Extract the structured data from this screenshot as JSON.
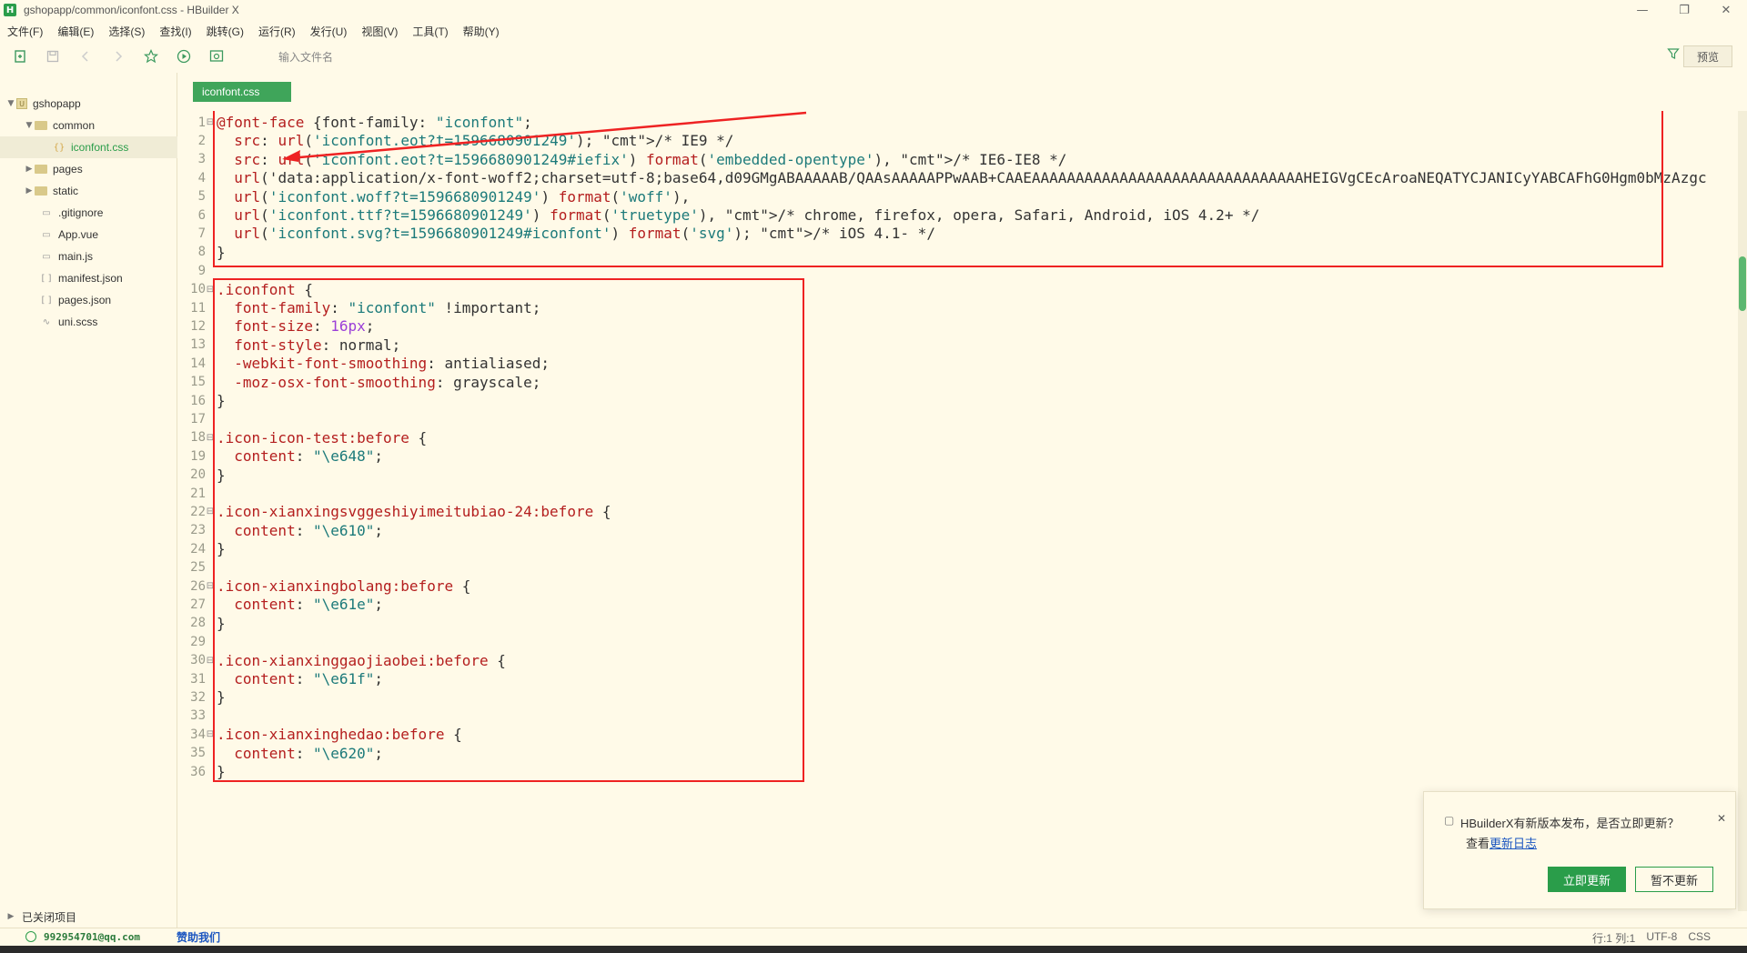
{
  "window": {
    "app_logo": "H",
    "title": "gshopapp/common/iconfont.css - HBuilder X",
    "controls": {
      "minimize": "—",
      "restore": "❐",
      "close": "✕"
    }
  },
  "menu": [
    "文件(F)",
    "编辑(E)",
    "选择(S)",
    "查找(I)",
    "跳转(G)",
    "运行(R)",
    "发行(U)",
    "视图(V)",
    "工具(T)",
    "帮助(Y)"
  ],
  "toolbar": {
    "search_placeholder": "输入文件名",
    "preview_label": "预览"
  },
  "sidebar": {
    "project": "gshopapp",
    "items": [
      {
        "label": "gshopapp",
        "type": "project"
      },
      {
        "label": "common",
        "type": "folder"
      },
      {
        "label": "iconfont.css",
        "type": "css"
      },
      {
        "label": "pages",
        "type": "folder"
      },
      {
        "label": "static",
        "type": "folder"
      },
      {
        "label": ".gitignore",
        "type": "file"
      },
      {
        "label": "App.vue",
        "type": "file"
      },
      {
        "label": "main.js",
        "type": "file"
      },
      {
        "label": "manifest.json",
        "type": "json"
      },
      {
        "label": "pages.json",
        "type": "json"
      },
      {
        "label": "uni.scss",
        "type": "file"
      }
    ],
    "footer": "已关闭项目"
  },
  "editor": {
    "tab_label": "iconfont.css",
    "lines": [
      "@font-face {font-family: \"iconfont\";",
      "  src: url('iconfont.eot?t=1596680901249'); /* IE9 */",
      "  src: url('iconfont.eot?t=1596680901249#iefix') format('embedded-opentype'), /* IE6-IE8 */",
      "  url('data:application/x-font-woff2;charset=utf-8;base64,d09GMgABAAAAAB/QAAsAAAAAPPwAAB+CAAEAAAAAAAAAAAAAAAAAAAAAAAAAAAAAAAHEIGVgCEcAroaNEQATYCJANICyYABCAFhG0Hgm0bMzAzgc",
      "  url('iconfont.woff?t=1596680901249') format('woff'),",
      "  url('iconfont.ttf?t=1596680901249') format('truetype'), /* chrome, firefox, opera, Safari, Android, iOS 4.2+ */",
      "  url('iconfont.svg?t=1596680901249#iconfont') format('svg'); /* iOS 4.1- */",
      "}",
      "",
      ".iconfont {",
      "  font-family: \"iconfont\" !important;",
      "  font-size: 16px;",
      "  font-style: normal;",
      "  -webkit-font-smoothing: antialiased;",
      "  -moz-osx-font-smoothing: grayscale;",
      "}",
      "",
      ".icon-icon-test:before {",
      "  content: \"\\e648\";",
      "}",
      "",
      ".icon-xianxingsvggeshiyimeitubiao-24:before {",
      "  content: \"\\e610\";",
      "}",
      "",
      ".icon-xianxingbolang:before {",
      "  content: \"\\e61e\";",
      "}",
      "",
      ".icon-xianxinggaojiaobei:before {",
      "  content: \"\\e61f\";",
      "}",
      "",
      ".icon-xianxinghedao:before {",
      "  content: \"\\e620\";",
      "}"
    ]
  },
  "status": {
    "user": "992954701@qq.com",
    "help": "赞助我们",
    "position": "行:1  列:1",
    "encoding": "UTF-8",
    "language": "CSS"
  },
  "popup": {
    "message": "HBuilderX有新版本发布，是否立即更新？",
    "sub_prefix": "查看",
    "sub_link": "更新日志",
    "primary": "立即更新",
    "secondary": "暂不更新"
  },
  "colors": {
    "background": "#fffae8",
    "accent": "#2a9d4a",
    "annotation": "#ee2222"
  }
}
